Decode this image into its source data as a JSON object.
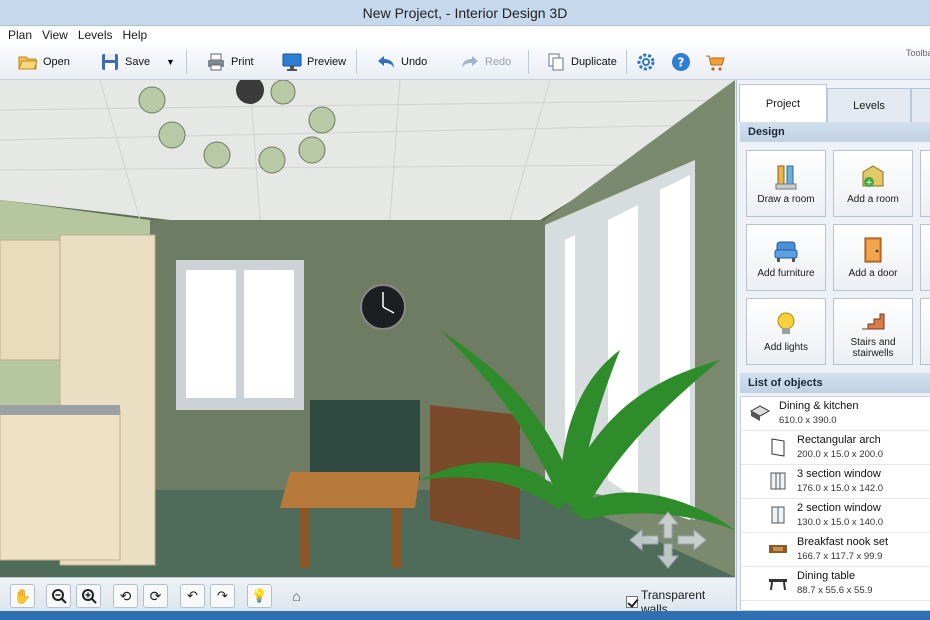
{
  "window": {
    "title": "New Project, - Interior Design 3D"
  },
  "menu": [
    "Plan",
    "View",
    "Levels",
    "Help"
  ],
  "toolbar": {
    "open": "Open",
    "save": "Save",
    "print": "Print",
    "preview": "Preview",
    "undo": "Undo",
    "redo": "Redo",
    "duplicate": "Duplicate",
    "label": "Toolba"
  },
  "viewport_controls": {
    "transparent_walls_label": "Transparent walls",
    "transparent_walls_checked": true
  },
  "tabs": [
    "Project",
    "Levels"
  ],
  "design": {
    "heading": "Design",
    "buttons": [
      "Draw a room",
      "Add a room",
      "Add furniture",
      "Add a door",
      "Add lights",
      "Stairs and stairwells"
    ]
  },
  "objects": {
    "heading": "List of objects",
    "items": [
      {
        "name": "Dining & kitchen",
        "dims": "610.0 x 390.0"
      },
      {
        "name": "Rectangular arch",
        "dims": "200.0 x 15.0 x 200.0"
      },
      {
        "name": "3 section window",
        "dims": "176.0 x 15.0 x 142.0"
      },
      {
        "name": "2 section window",
        "dims": "130.0 x 15.0 x 140.0"
      },
      {
        "name": "Breakfast nook set",
        "dims": "166.7 x 117.7 x 99.9"
      },
      {
        "name": "Dining table",
        "dims": "88.7 x 55.6 x 55.9"
      }
    ]
  },
  "colors": {
    "accent": "#2f6fb3",
    "title_bar": "#c6d9ec",
    "section_head": "#c9d9ea"
  }
}
